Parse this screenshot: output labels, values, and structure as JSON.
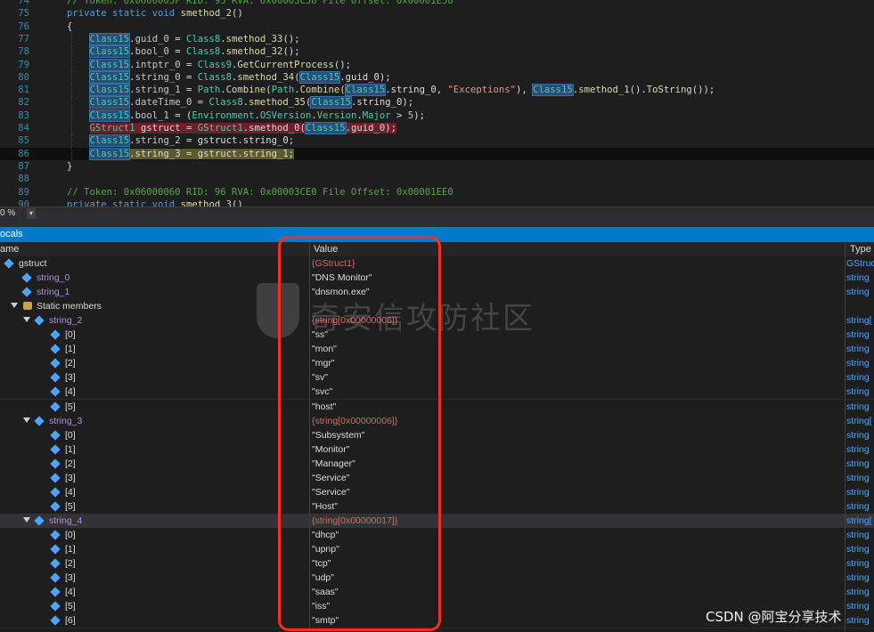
{
  "editor": {
    "lines": [
      {
        "n": "74",
        "html": "<span class='cm'>// Token: 0x0600005F RID: 95 RVA: 0x00003C58 File Offset: 0x00001E58</span>"
      },
      {
        "n": "75",
        "html": "<span class='kw'>private static void</span> <span class='fn'>smethod_2</span>()"
      },
      {
        "n": "76",
        "html": "{"
      },
      {
        "n": "77",
        "html": "    <span class='cls'>Class15</span>.<span class='pr'>guid_0</span> = <span class='ty'>Class8</span>.<span class='fn'>smethod_33</span>();"
      },
      {
        "n": "78",
        "html": "    <span class='cls'>Class15</span>.<span class='pr'>bool_0</span> = <span class='ty'>Class8</span>.<span class='fn'>smethod_32</span>();"
      },
      {
        "n": "79",
        "html": "    <span class='cls'>Class15</span>.<span class='pr'>intptr_0</span> = <span class='ty'>Class9</span>.<span class='fn'>GetCurrentProcess</span>();"
      },
      {
        "n": "80",
        "html": "    <span class='cls'>Class15</span>.<span class='pr'>string_0</span> = <span class='ty'>Class8</span>.<span class='fn'>smethod_34</span>(<span class='cls'>Class15</span>.guid_0);"
      },
      {
        "n": "81",
        "html": "    <span class='cls'>Class15</span>.<span class='pr'>string_1</span> = <span class='ty'>Path</span>.<span class='fn'>Combine</span>(<span class='ty'>Path</span>.<span class='fn'>Combine</span>(<span class='cls'>Class15</span>.string_0, <span class='st'>\"Exceptions\"</span>), <span class='cls'>Class15</span>.<span class='fn'>smethod_1</span>().<span class='fn'>ToString</span>());"
      },
      {
        "n": "82",
        "html": "    <span class='cls'>Class15</span>.<span class='pr'>dateTime_0</span> = <span class='ty'>Class8</span>.<span class='fn'>smethod_35</span>(<span class='cls'>Class15</span>.string_0);"
      },
      {
        "n": "83",
        "html": "    <span class='cls'>Class15</span>.<span class='pr'>bool_1</span> = (<span class='ty'>Environment</span>.<span class='ty'>OSVersion</span>.<span class='ty'>Version</span>.<span class='ty'>Major</span> > <span class='nm'>5</span>);"
      },
      {
        "n": "84",
        "html": "    <span class='err'><span class='ty'>GStruct1</span> gstruct = <span class='ty'>GStruct1</span>.smethod_0(<span class='cls'>Class15</span>.guid_0);</span>"
      },
      {
        "n": "85",
        "html": "    <span class='cls'>Class15</span>.<span class='pr'>string_2</span> = gstruct.string_0;"
      },
      {
        "n": "86",
        "html": "    <span class='cls'>Class15</span><span class='warn'>.string_3 = gstruct.string_1;</span>"
      },
      {
        "n": "87",
        "html": "}"
      },
      {
        "n": "88",
        "html": ""
      },
      {
        "n": "89",
        "html": "<span class='cm'>// Token: 0x06000060 RID: 96 RVA: 0x00003CE0 File Offset: 0x00001EE0</span>"
      },
      {
        "n": "90",
        "html": "<span class='kw'>private static void</span> <span class='fn'>smethod_3</span>()"
      }
    ],
    "zoom": "0 %"
  },
  "panel": {
    "title": "ocals",
    "col_name": "ame",
    "col_value": "Value",
    "col_type": "Type"
  },
  "rows": [
    {
      "indent": 0,
      "exp": "none",
      "icon": "field",
      "name": "gstruct",
      "cls": "",
      "val": "{GStruct1}",
      "valcls": "obj",
      "typ": "GStruc"
    },
    {
      "indent": 1,
      "exp": "none",
      "icon": "field",
      "name": "string_0",
      "cls": "field",
      "val": "\"DNS Monitor\"",
      "valcls": "",
      "typ": "string"
    },
    {
      "indent": 1,
      "exp": "none",
      "icon": "field",
      "name": "string_1",
      "cls": "field",
      "val": "\"dnsmon.exe\"",
      "valcls": "",
      "typ": "string"
    },
    {
      "indent": 1,
      "exp": "open",
      "icon": "static",
      "name": "Static members",
      "cls": "",
      "val": "",
      "valcls": "",
      "typ": ""
    },
    {
      "indent": 2,
      "exp": "open",
      "icon": "field",
      "name": "string_2",
      "cls": "field",
      "val": "{string[0x00000006]}",
      "valcls": "obj",
      "typ": "string["
    },
    {
      "indent": 3,
      "exp": "none",
      "icon": "field",
      "name": "[0]",
      "cls": "",
      "val": "\"ss\"",
      "valcls": "",
      "typ": "string"
    },
    {
      "indent": 3,
      "exp": "none",
      "icon": "field",
      "name": "[1]",
      "cls": "",
      "val": "\"mon\"",
      "valcls": "",
      "typ": "string"
    },
    {
      "indent": 3,
      "exp": "none",
      "icon": "field",
      "name": "[2]",
      "cls": "",
      "val": "\"mgr\"",
      "valcls": "",
      "typ": "string"
    },
    {
      "indent": 3,
      "exp": "none",
      "icon": "field",
      "name": "[3]",
      "cls": "",
      "val": "\"sv\"",
      "valcls": "",
      "typ": "string"
    },
    {
      "indent": 3,
      "exp": "none",
      "icon": "field",
      "name": "[4]",
      "cls": "",
      "val": "\"svc\"",
      "valcls": "",
      "typ": "string"
    },
    {
      "indent": 3,
      "exp": "none",
      "icon": "field",
      "name": "[5]",
      "cls": "",
      "val": "\"host\"",
      "valcls": "",
      "typ": "string"
    },
    {
      "indent": 2,
      "exp": "open",
      "icon": "field",
      "name": "string_3",
      "cls": "field",
      "val": "{string[0x00000006]}",
      "valcls": "obj",
      "typ": "string["
    },
    {
      "indent": 3,
      "exp": "none",
      "icon": "field",
      "name": "[0]",
      "cls": "",
      "val": "\"Subsystem\"",
      "valcls": "",
      "typ": "string"
    },
    {
      "indent": 3,
      "exp": "none",
      "icon": "field",
      "name": "[1]",
      "cls": "",
      "val": "\"Monitor\"",
      "valcls": "",
      "typ": "string"
    },
    {
      "indent": 3,
      "exp": "none",
      "icon": "field",
      "name": "[2]",
      "cls": "",
      "val": "\"Manager\"",
      "valcls": "",
      "typ": "string"
    },
    {
      "indent": 3,
      "exp": "none",
      "icon": "field",
      "name": "[3]",
      "cls": "",
      "val": "\"Service\"",
      "valcls": "",
      "typ": "string"
    },
    {
      "indent": 3,
      "exp": "none",
      "icon": "field",
      "name": "[4]",
      "cls": "",
      "val": "\"Service\"",
      "valcls": "",
      "typ": "string"
    },
    {
      "indent": 3,
      "exp": "none",
      "icon": "field",
      "name": "[5]",
      "cls": "",
      "val": "\"Host\"",
      "valcls": "",
      "typ": "string"
    },
    {
      "indent": 2,
      "exp": "open",
      "icon": "field",
      "name": "string_4",
      "cls": "field",
      "val": "{string[0x00000017]}",
      "valcls": "obj",
      "typ": "string[",
      "sel": true
    },
    {
      "indent": 3,
      "exp": "none",
      "icon": "field",
      "name": "[0]",
      "cls": "",
      "val": "\"dhcp\"",
      "valcls": "",
      "typ": "string"
    },
    {
      "indent": 3,
      "exp": "none",
      "icon": "field",
      "name": "[1]",
      "cls": "",
      "val": "\"upnp\"",
      "valcls": "",
      "typ": "string"
    },
    {
      "indent": 3,
      "exp": "none",
      "icon": "field",
      "name": "[2]",
      "cls": "",
      "val": "\"tcp\"",
      "valcls": "",
      "typ": "string"
    },
    {
      "indent": 3,
      "exp": "none",
      "icon": "field",
      "name": "[3]",
      "cls": "",
      "val": "\"udp\"",
      "valcls": "",
      "typ": "string"
    },
    {
      "indent": 3,
      "exp": "none",
      "icon": "field",
      "name": "[4]",
      "cls": "",
      "val": "\"saas\"",
      "valcls": "",
      "typ": "string"
    },
    {
      "indent": 3,
      "exp": "none",
      "icon": "field",
      "name": "[5]",
      "cls": "",
      "val": "\"iss\"",
      "valcls": "",
      "typ": "string"
    },
    {
      "indent": 3,
      "exp": "none",
      "icon": "field",
      "name": "[6]",
      "cls": "",
      "val": "\"smtp\"",
      "valcls": "",
      "typ": "string"
    }
  ],
  "overlay": {
    "watermark_text": "奇安信攻防社区",
    "credit": "CSDN @阿宝分享技术"
  },
  "colors": {
    "accent": "#007acc",
    "highlight_box": "#ff2b1c"
  }
}
